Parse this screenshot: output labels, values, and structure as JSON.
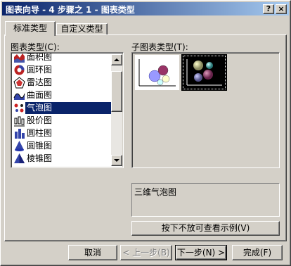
{
  "window": {
    "title": "图表向导 - 4 步骤之 1 - 图表类型",
    "help_glyph": "?",
    "close_glyph": "×"
  },
  "tabs": [
    {
      "label": "标准类型"
    },
    {
      "label": "自定义类型"
    }
  ],
  "chart_type_label": "图表类型(C):",
  "chart_types": [
    {
      "label": "面积图",
      "icon": "area-chart-icon"
    },
    {
      "label": "圆环图",
      "icon": "doughnut-chart-icon"
    },
    {
      "label": "雷达图",
      "icon": "radar-chart-icon"
    },
    {
      "label": "曲面图",
      "icon": "surface-chart-icon"
    },
    {
      "label": "气泡图",
      "icon": "bubble-chart-icon",
      "selected": true
    },
    {
      "label": "股价图",
      "icon": "stock-chart-icon"
    },
    {
      "label": "圆柱图",
      "icon": "cylinder-chart-icon"
    },
    {
      "label": "圆锥图",
      "icon": "cone-chart-icon"
    },
    {
      "label": "棱锥图",
      "icon": "pyramid-chart-icon"
    }
  ],
  "subtype_label": "子图表类型(T):",
  "subtype_description": "三维气泡图",
  "preview_button": "按下不放可查看示例(V)",
  "buttons": {
    "cancel": "取消",
    "back": "< 上一步(B)",
    "next": "下一步(N) >",
    "finish": "完成(F)"
  },
  "colors": {
    "title_start": "#0a246a",
    "title_end": "#a6caf0",
    "selection": "#0a246a",
    "face": "#d4d0c8"
  }
}
